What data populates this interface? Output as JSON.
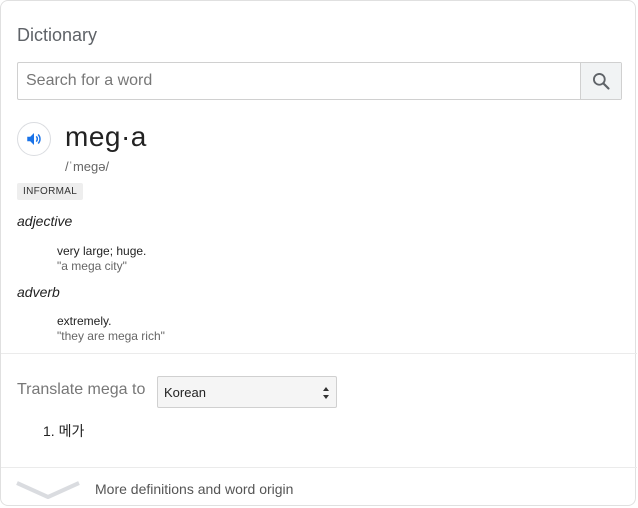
{
  "header": {
    "title": "Dictionary"
  },
  "search": {
    "placeholder": "Search for a word",
    "value": ""
  },
  "entry": {
    "word": "meg·a",
    "phonetic": "/ˈmeɡə/",
    "register_badge": "INFORMAL",
    "senses": [
      {
        "part_of_speech": "adjective",
        "definition": "very large; huge.",
        "example": "\"a mega city\""
      },
      {
        "part_of_speech": "adverb",
        "definition": "extremely.",
        "example": "\"they are mega rich\""
      }
    ]
  },
  "translate": {
    "label": "Translate mega to",
    "selected_language": "Korean",
    "results": [
      {
        "number": "1.",
        "text": "메가"
      }
    ]
  },
  "footer": {
    "more_label": "More definitions and word origin"
  },
  "colors": {
    "speaker_blue": "#1a73e8",
    "icon_gray": "#5f6368"
  },
  "icons": {
    "search": "search-icon",
    "speaker": "speaker-icon",
    "expand": "chevron-down-icon"
  }
}
